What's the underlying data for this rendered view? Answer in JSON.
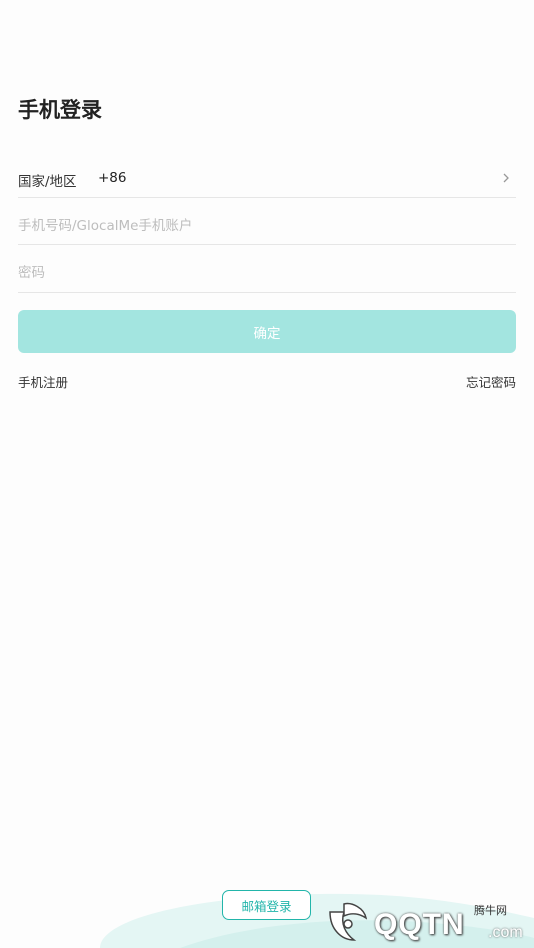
{
  "page": {
    "title": "手机登录"
  },
  "form": {
    "country_label": "国家/地区",
    "country_code": "+86",
    "phone_placeholder": "手机号码/GlocalMe手机账户",
    "password_placeholder": "密码",
    "confirm_label": "确定"
  },
  "links": {
    "register": "手机注册",
    "forgot_password": "忘记密码"
  },
  "footer": {
    "email_login": "邮箱登录"
  },
  "watermark": {
    "logo_text": "QQTN",
    "cn_text": "腾牛网",
    "com_text": ".com"
  },
  "colors": {
    "accent": "#22b5aa",
    "button_disabled": "#a3e5e0",
    "wave": "#e4f6f4"
  },
  "icons": {
    "country_chevron": "chevron-right-icon"
  }
}
